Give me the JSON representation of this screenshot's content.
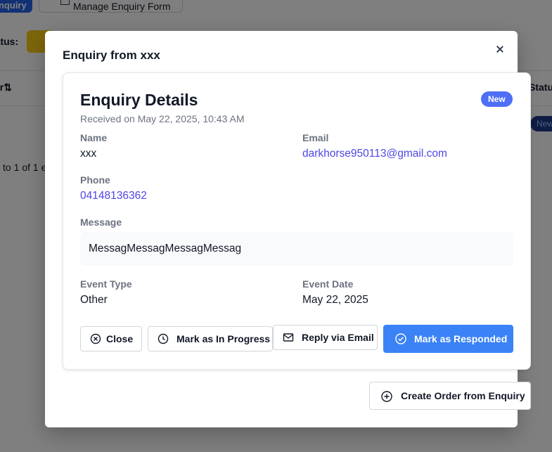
{
  "background": {
    "primary_button": "nquiry",
    "secondary_button": "Manage Enquiry Form",
    "status_label": "tatus:",
    "table_header_left": "er⇅",
    "table_header_right": "Statu",
    "row_badge": "New",
    "pagination": "to 1 of 1 e"
  },
  "modal": {
    "title": "Enquiry from xxx",
    "close_icon": "close-icon",
    "card": {
      "title": "Enquiry Details",
      "received": "Received on May 22, 2025, 10:43 AM",
      "status_badge": "New",
      "fields": {
        "name_label": "Name",
        "name_value": "xxx",
        "email_label": "Email",
        "email_value": "darkhorse950113@gmail.com",
        "phone_label": "Phone",
        "phone_value": "04148136362",
        "message_label": "Message",
        "message_value": "MessagMessagMessagMessag",
        "event_type_label": "Event Type",
        "event_type_value": "Other",
        "event_date_label": "Event Date",
        "event_date_value": "May 22, 2025"
      },
      "actions": {
        "close": "Close",
        "in_progress": "Mark as In Progress",
        "reply": "Reply via Email",
        "responded": "Mark as Responded"
      }
    },
    "create_order": "Create Order from Enquiry"
  },
  "colors": {
    "accent": "#3b82f6",
    "badge": "#4f6ef7",
    "link": "#4f46e5"
  }
}
